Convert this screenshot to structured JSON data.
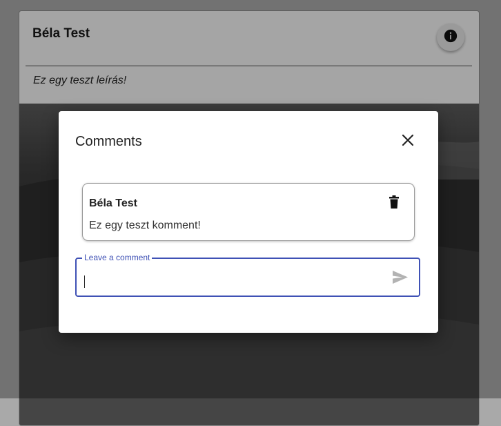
{
  "post": {
    "author": "Béla Test",
    "description": "Ez egy teszt leírás!",
    "info_icon": "info-icon",
    "image_alt": "landscape"
  },
  "modal": {
    "title": "Comments",
    "close_icon": "close-icon",
    "comments": [
      {
        "author": "Béla Test",
        "text": "Ez egy teszt komment!",
        "delete_icon": "trash-icon"
      }
    ],
    "input": {
      "label": "Leave a comment",
      "value": "",
      "send_icon": "send-icon"
    }
  },
  "colors": {
    "accent": "#3f51b5",
    "backdrop": "#a9a9a9"
  }
}
